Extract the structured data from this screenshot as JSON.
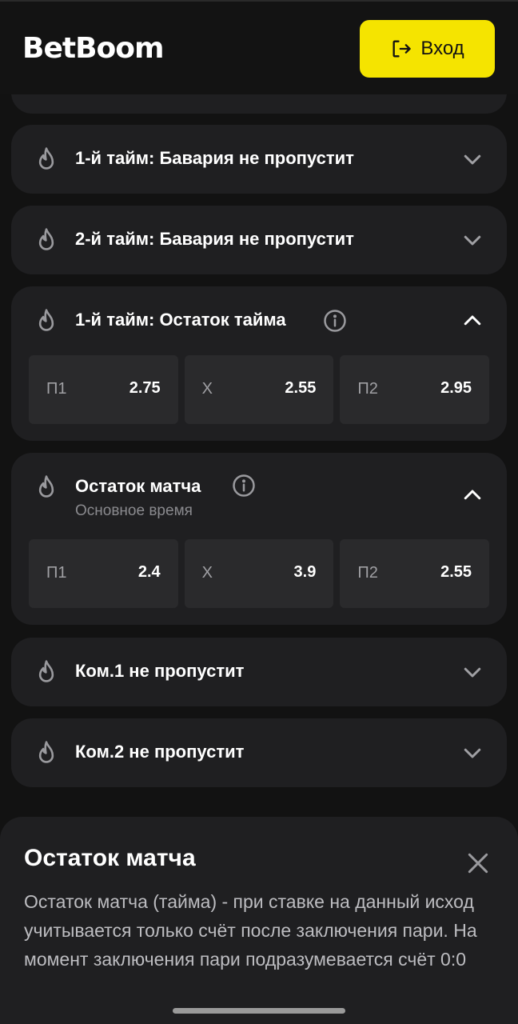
{
  "header": {
    "logo": "BetBoom",
    "login_label": "Вход"
  },
  "markets": [
    {
      "title": "1-й тайм: Бавария не пропустит",
      "expanded": false
    },
    {
      "title": "2-й тайм: Бавария не пропустит",
      "expanded": false
    },
    {
      "title": "1-й тайм: Остаток тайма",
      "expanded": true,
      "has_info": true,
      "odds": [
        {
          "label": "П1",
          "value": "2.75"
        },
        {
          "label": "Х",
          "value": "2.55"
        },
        {
          "label": "П2",
          "value": "2.95"
        }
      ]
    },
    {
      "title": "Остаток матча",
      "subtitle": "Основное время",
      "expanded": true,
      "has_info": true,
      "odds": [
        {
          "label": "П1",
          "value": "2.4"
        },
        {
          "label": "Х",
          "value": "3.9"
        },
        {
          "label": "П2",
          "value": "2.55"
        }
      ]
    },
    {
      "title": "Ком.1 не пропустит",
      "expanded": false
    },
    {
      "title": "Ком.2 не пропустит",
      "expanded": false
    }
  ],
  "sheet": {
    "title": "Остаток матча",
    "body": "Остаток матча (тайма) - при ставке на данный исход учитывается только счёт после заключения пари. На момент заключения пари подразумевается счёт 0:0"
  },
  "icons": {
    "fire": "fire-icon",
    "info": "info-icon",
    "chevron_down": "chevron-down-icon",
    "chevron_up": "chevron-up-icon",
    "close": "close-icon",
    "login": "login-icon"
  },
  "colors": {
    "accent": "#f5e400",
    "background": "#121212",
    "card": "#1f1f21",
    "odd_cell": "#2a2a2c"
  }
}
